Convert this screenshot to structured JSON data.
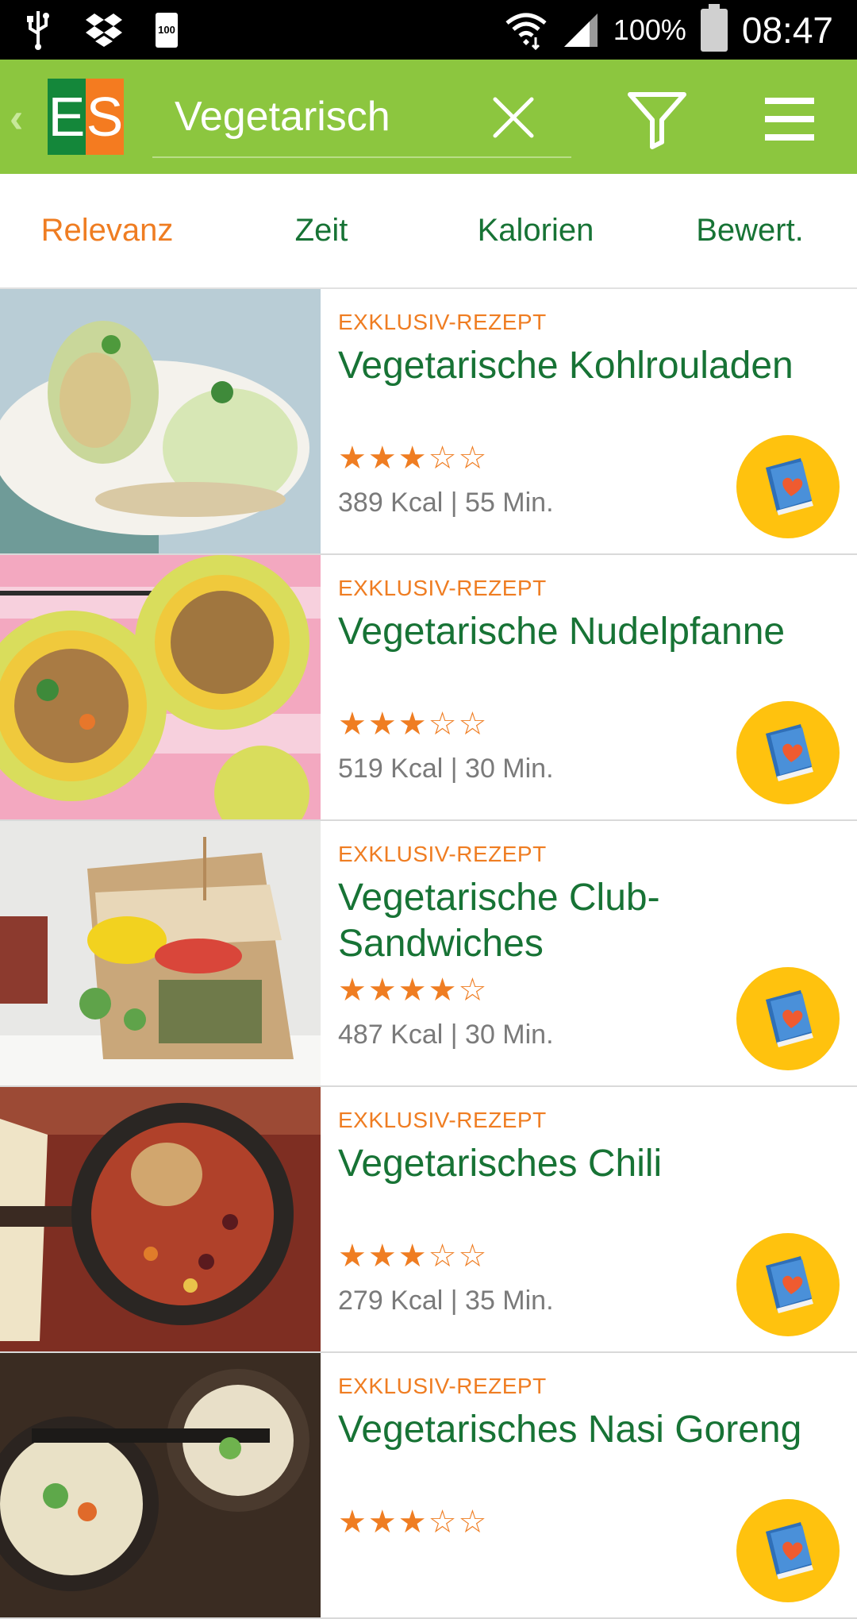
{
  "status_bar": {
    "battery_small_label": "100",
    "battery_percent": "100%",
    "time": "08:47",
    "icons": [
      "usb-icon",
      "dropbox-icon",
      "battery-small-icon",
      "wifi-icon",
      "signal-icon",
      "battery-icon"
    ]
  },
  "app_bar": {
    "logo_letters": [
      "E",
      "S"
    ],
    "search_value": "Vegetarisch",
    "colors": {
      "bar": "#8cc63f",
      "logo_green": "#14873a",
      "logo_orange": "#f47b20"
    }
  },
  "sort_tabs": [
    {
      "label": "Relevanz",
      "active": true
    },
    {
      "label": "Zeit",
      "active": false
    },
    {
      "label": "Kalorien",
      "active": false
    },
    {
      "label": "Bewert.",
      "active": false
    }
  ],
  "recipes": [
    {
      "tag": "EXKLUSIV-REZEPT",
      "title": "Vegetarische Kohlrouladen",
      "rating": 3,
      "rating_max": 5,
      "meta": "389 Kcal | 55 Min."
    },
    {
      "tag": "EXKLUSIV-REZEPT",
      "title": "Vegetarische Nudelpfanne",
      "rating": 3,
      "rating_max": 5,
      "meta": "519 Kcal | 30 Min."
    },
    {
      "tag": "EXKLUSIV-REZEPT",
      "title": "Vegetarische Club-Sandwiches",
      "rating": 4,
      "rating_max": 5,
      "meta": "487 Kcal | 30 Min."
    },
    {
      "tag": "EXKLUSIV-REZEPT",
      "title": "Vegetarisches Chili",
      "rating": 3,
      "rating_max": 5,
      "meta": "279 Kcal | 35 Min."
    },
    {
      "tag": "EXKLUSIV-REZEPT",
      "title": "Vegetarisches Nasi Goreng",
      "rating": 3,
      "rating_max": 5,
      "meta": ""
    }
  ],
  "accent_colors": {
    "orange": "#ef7d22",
    "green": "#177335",
    "fav": "#ffc20e"
  }
}
